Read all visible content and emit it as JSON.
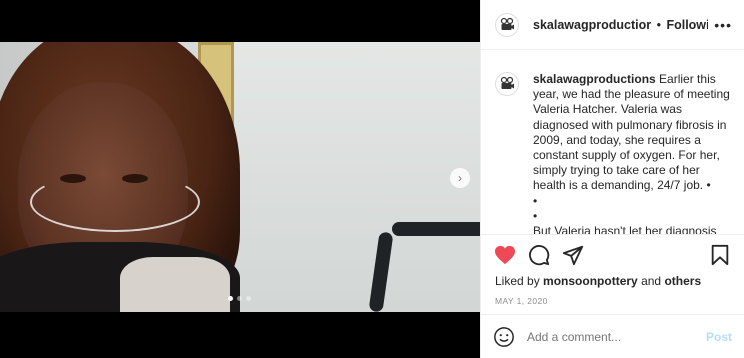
{
  "header": {
    "username": "skalawagproductior",
    "separator": "•",
    "follow_status": "Following",
    "more": "•••"
  },
  "caption": {
    "username": "skalawagproductions",
    "line1": "Earlier this year, we had the pleasure of meeting Valeria Hatcher. Valeria was diagnosed with pulmonary fibrosis in 2009, and today, she requires a constant supply of oxygen. For her, simply trying to take care of her health is a demanding, 24/7 job. •",
    "bullet1": "•",
    "bullet2": "•",
    "line2": "But Valeria hasn't let her diagnosis stop her from connecting with—and"
  },
  "likes": {
    "prefix": "Liked by",
    "user": "monsoonpottery",
    "middle": "and",
    "others": "others"
  },
  "date": "MAY 1, 2020",
  "comment": {
    "placeholder": "Add a comment...",
    "post_label": "Post"
  },
  "carousel": {
    "total": 3,
    "active_index": 0
  },
  "colors": {
    "heart": "#ed4956",
    "post_disabled": "#b2dffc",
    "text": "#262626",
    "muted": "#8e8e8e"
  }
}
